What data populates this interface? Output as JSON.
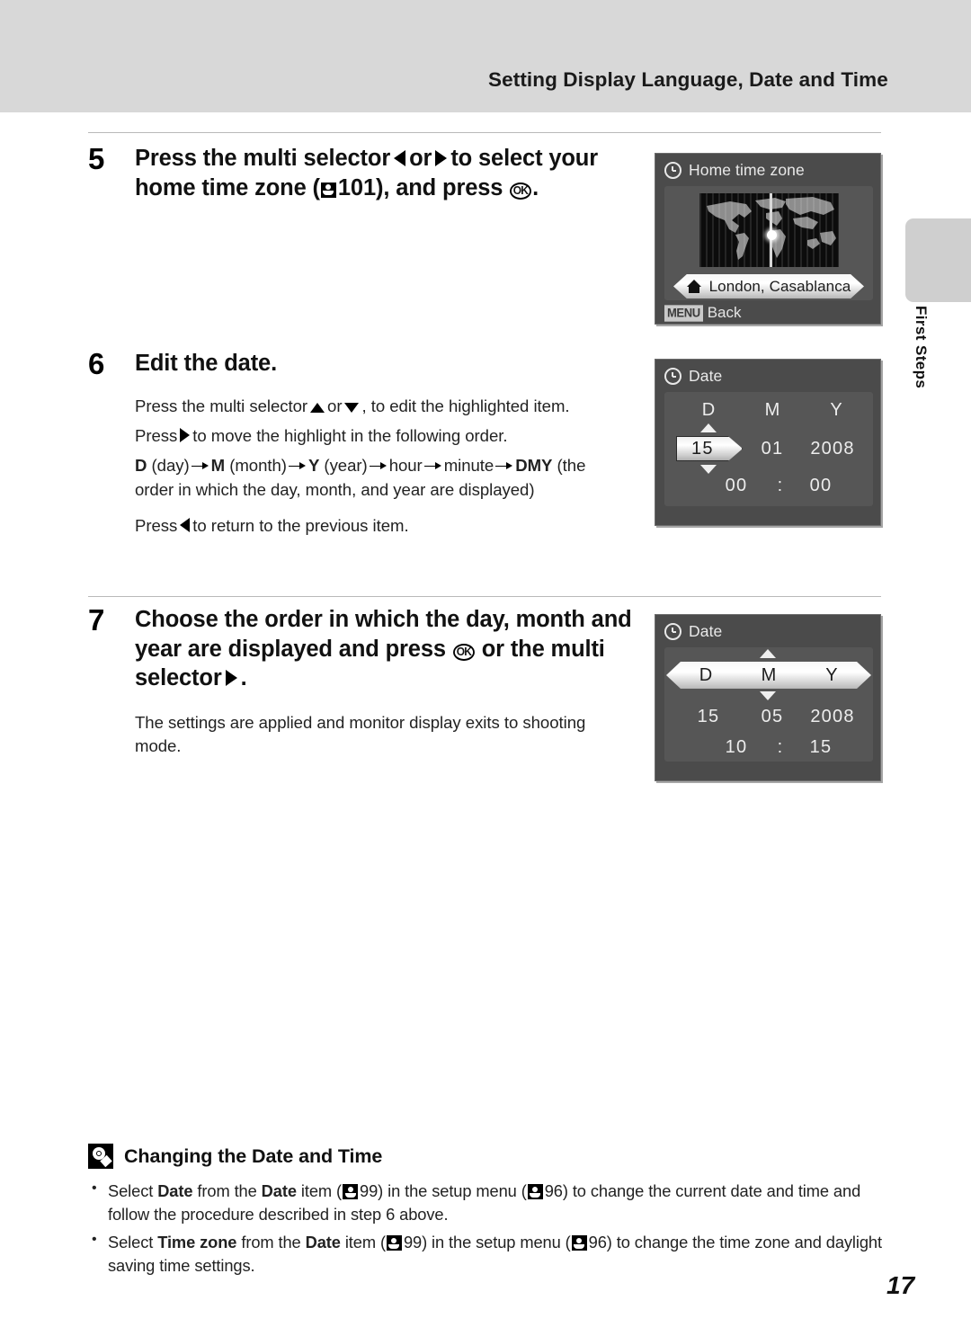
{
  "header": {
    "title": "Setting Display Language, Date and Time"
  },
  "side_tab": {
    "label": "First Steps"
  },
  "steps": [
    {
      "number": "5",
      "heading_part1": "Press the multi selector",
      "heading_part2": "or",
      "heading_part3": "to select your home time zone (",
      "heading_ref": "101",
      "heading_part4": "), and press",
      "ok_label": "OK",
      "heading_end": "."
    },
    {
      "number": "6",
      "heading": "Edit the date.",
      "body": {
        "line1_a": "Press the multi selector",
        "line1_b": "or",
        "line1_c": ", to edit the highlighted item.",
        "line2_a": "Press",
        "line2_b": "to move the highlight in the following order.",
        "order": {
          "d": "D",
          "d_word": "(day)",
          "m": "M",
          "m_word": "(month)",
          "y": "Y",
          "y_word": "(year)",
          "hour": "hour",
          "minute": "minute",
          "dmy": "DMY",
          "dmy_word": "(the order in which the day, month, and year are displayed)"
        },
        "line3_a": "Press",
        "line3_b": "to return to the previous item."
      }
    },
    {
      "number": "7",
      "heading_part1": "Choose the order in which the day, month and year are displayed and press",
      "ok_label": "OK",
      "heading_part2": "or the multi selector",
      "heading_end": ".",
      "body": "The settings are applied and monitor display exits to shooting mode."
    }
  ],
  "screens": {
    "home_time_zone": {
      "title": "Home time zone",
      "icon": "clock-icon",
      "banner_text": "London, Casablanca",
      "banner_icon": "house-icon",
      "menu_chip": "MENU",
      "menu_label": "Back"
    },
    "date_step6": {
      "title": "Date",
      "icon": "clock-icon",
      "headers": [
        "D",
        "M",
        "Y"
      ],
      "selected_index": 0,
      "selected_value": "15",
      "month": "01",
      "year": "2008",
      "hour": "00",
      "colon": ":",
      "minute": "00"
    },
    "date_step7": {
      "title": "Date",
      "icon": "clock-icon",
      "order_letters": [
        "D",
        "M",
        "Y"
      ],
      "day": "15",
      "month": "05",
      "year": "2008",
      "hour": "10",
      "colon": ":",
      "minute": "15"
    }
  },
  "note": {
    "icon": "lightbulb-icon",
    "title": "Changing the Date and Time",
    "items": [
      {
        "a": "Select",
        "bold1": "Date",
        "b": "from the",
        "bold2": "Date",
        "c": "item (",
        "ref1": "99",
        "d": ") in the setup menu (",
        "ref2": "96",
        "e": ") to change the current date and time and follow the procedure described in step 6 above."
      },
      {
        "a": "Select",
        "bold1": "Time zone",
        "b": "from the",
        "bold2": "Date",
        "c": "item (",
        "ref1": "99",
        "d": ") in the setup menu (",
        "ref2": "96",
        "e": ") to change the time zone and daylight saving time settings."
      }
    ]
  },
  "page_number": "17",
  "colors": {
    "header_bg": "#d8d8d8",
    "screen_bg": "#4b4b4b",
    "screen_inner": "#565656",
    "rule": "#b9b9b9"
  }
}
